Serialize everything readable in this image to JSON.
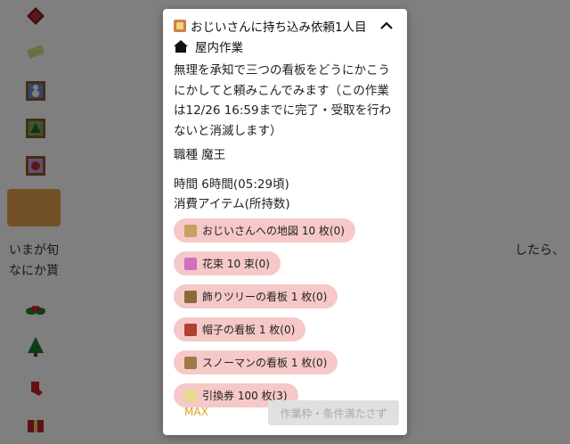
{
  "background": {
    "partial_texts": [
      "いまが旬",
      "なにか貰",
      "したら、"
    ]
  },
  "modal": {
    "title": "おじいさんに持ち込み依頼1人目",
    "type_label": "屋内作業",
    "description": "無理を承知で三つの看板をどうにかこうにかしてと頼みこんでみます（この作業は12/26 16:59までに完了・受取を行わないと消滅します）",
    "job": "職種 魔王",
    "time": "時間 6時間(05:29頃)",
    "consume_label": "消費アイテム(所持数)",
    "items": [
      {
        "label": "おじいさんへの地図 10 枚(0)",
        "icon": "map-icon",
        "color": "#c8a060"
      },
      {
        "label": "花束 10 束(0)",
        "icon": "bouquet-icon",
        "color": "#d070c0"
      },
      {
        "label": "飾りツリーの看板 1 枚(0)",
        "icon": "tree-sign-icon",
        "color": "#8a6a3a"
      },
      {
        "label": "帽子の看板 1 枚(0)",
        "icon": "hat-sign-icon",
        "color": "#b04030"
      },
      {
        "label": "スノーマンの看板 1 枚(0)",
        "icon": "snowman-sign-icon",
        "color": "#a07848"
      },
      {
        "label": "引換券 100 枚(3)",
        "icon": "ticket-icon",
        "color": "#e8d890"
      }
    ],
    "max_label": "MAX",
    "submit_label": "作業枠・条件満たさず"
  }
}
